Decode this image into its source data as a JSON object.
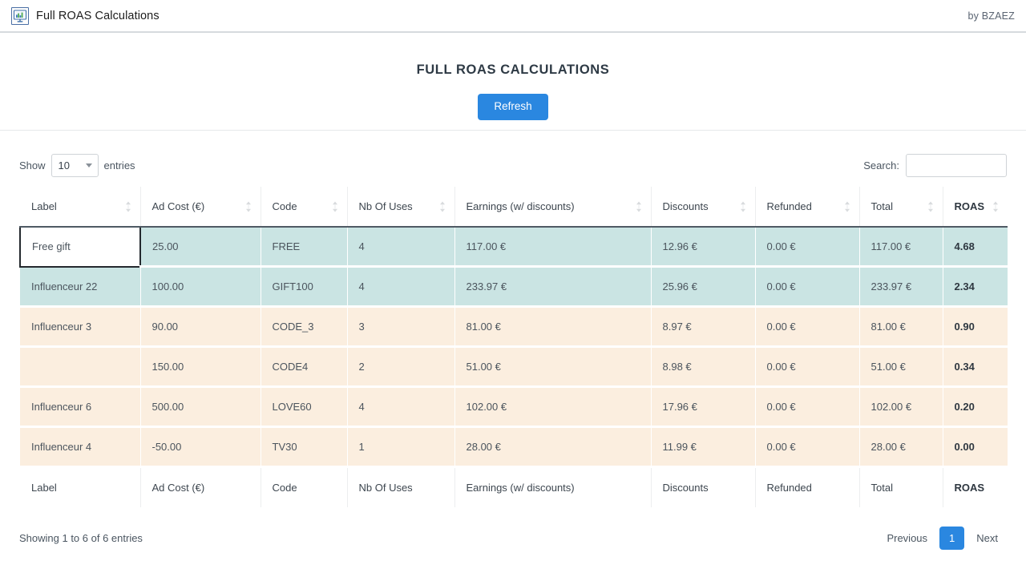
{
  "appbar": {
    "icon": "chart-monitor-icon",
    "title": "Full ROAS Calculations",
    "credit": "by BZAEZ"
  },
  "hero": {
    "page_title": "FULL ROAS CALCULATIONS",
    "refresh_label": "Refresh",
    "accent_color": "#2a87e0"
  },
  "table_controls": {
    "show_label": "Show",
    "entries_label": "entries",
    "page_length": "10",
    "search_label": "Search:",
    "search_value": "",
    "search_placeholder": ""
  },
  "table": {
    "columns": [
      "Label",
      "Ad Cost (€)",
      "Code",
      "Nb Of Uses",
      "Earnings (w/ discounts)",
      "Discounts",
      "Refunded",
      "Total",
      "ROAS"
    ],
    "rows": [
      {
        "label": "Free gift",
        "ad_cost": "25.00",
        "code": "FREE",
        "nb_of_uses": "4",
        "earnings": "117.00 €",
        "discounts": "12.96 €",
        "refunded": "0.00 €",
        "total": "117.00 €",
        "roas": "4.68",
        "tone": "teal",
        "label_focused": true
      },
      {
        "label": "Influenceur 22",
        "ad_cost": "100.00",
        "code": "GIFT100",
        "nb_of_uses": "4",
        "earnings": "233.97 €",
        "discounts": "25.96 €",
        "refunded": "0.00 €",
        "total": "233.97 €",
        "roas": "2.34",
        "tone": "teal",
        "label_focused": false
      },
      {
        "label": "Influenceur 3",
        "ad_cost": "90.00",
        "code": "CODE_3",
        "nb_of_uses": "3",
        "earnings": "81.00 €",
        "discounts": "8.97 €",
        "refunded": "0.00 €",
        "total": "81.00 €",
        "roas": "0.90",
        "tone": "peach",
        "label_focused": false
      },
      {
        "label": "",
        "ad_cost": "150.00",
        "code": "CODE4",
        "nb_of_uses": "2",
        "earnings": "51.00 €",
        "discounts": "8.98 €",
        "refunded": "0.00 €",
        "total": "51.00 €",
        "roas": "0.34",
        "tone": "peach",
        "label_focused": false
      },
      {
        "label": "Influenceur 6",
        "ad_cost": "500.00",
        "code": "LOVE60",
        "nb_of_uses": "4",
        "earnings": "102.00 €",
        "discounts": "17.96 €",
        "refunded": "0.00 €",
        "total": "102.00 €",
        "roas": "0.20",
        "tone": "peach",
        "label_focused": false
      },
      {
        "label": "Influenceur 4",
        "ad_cost": "-50.00",
        "code": "TV30",
        "nb_of_uses": "1",
        "earnings": "28.00 €",
        "discounts": "11.99 €",
        "refunded": "0.00 €",
        "total": "28.00 €",
        "roas": "0.00",
        "tone": "peach",
        "label_focused": false
      }
    ],
    "row_tone_colors": {
      "teal": "#cae4e3",
      "peach": "#fbeedf"
    }
  },
  "pagination": {
    "info": "Showing 1 to 6 of 6 entries",
    "previous_label": "Previous",
    "next_label": "Next",
    "pages": [
      "1"
    ],
    "current_page": "1"
  }
}
